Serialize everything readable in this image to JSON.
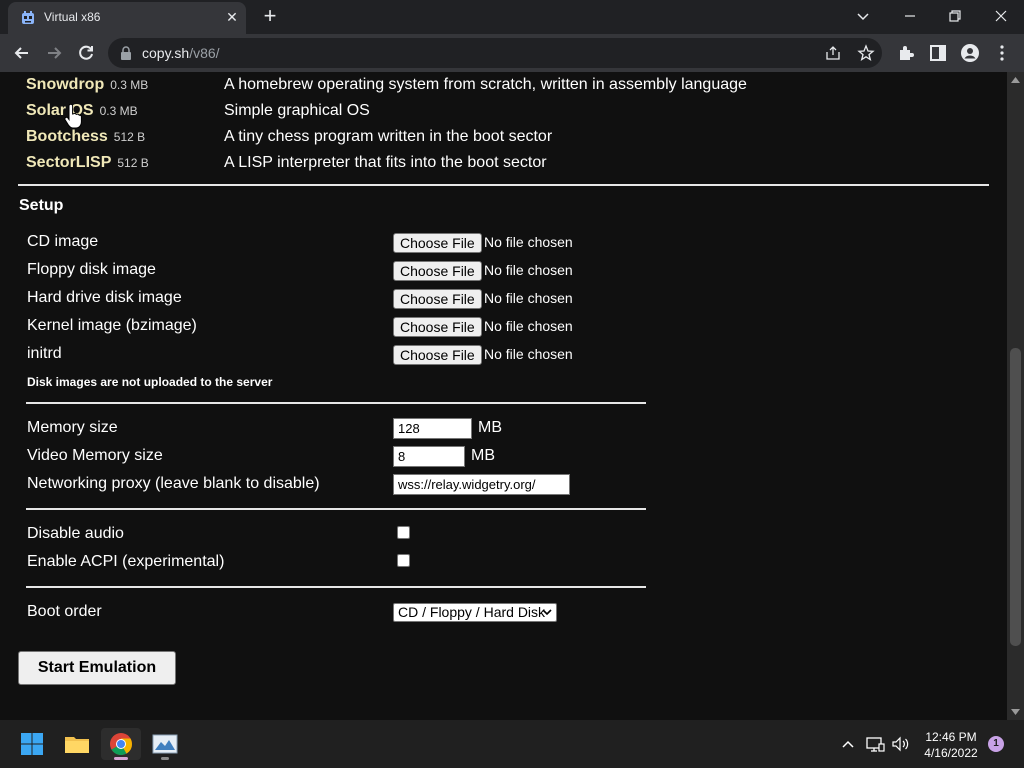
{
  "browser": {
    "tab_title": "Virtual x86",
    "url_host": "copy.sh",
    "url_path": "/v86/"
  },
  "os_list": [
    {
      "name": "Snowdrop",
      "size": "0.3 MB",
      "description": "A homebrew operating system from scratch, written in assembly language"
    },
    {
      "name": "Solar OS",
      "size": "0.3 MB",
      "description": "Simple graphical OS"
    },
    {
      "name": "Bootchess",
      "size": "512 B",
      "description": "A tiny chess program written in the boot sector"
    },
    {
      "name": "SectorLISP",
      "size": "512 B",
      "description": "A LISP interpreter that fits into the boot sector"
    }
  ],
  "setup": {
    "title": "Setup",
    "file_inputs": [
      {
        "label": "CD image",
        "button": "Choose File",
        "status": "No file chosen"
      },
      {
        "label": "Floppy disk image",
        "button": "Choose File",
        "status": "No file chosen"
      },
      {
        "label": "Hard drive disk image",
        "button": "Choose File",
        "status": "No file chosen"
      },
      {
        "label": "Kernel image (bzimage)",
        "button": "Choose File",
        "status": "No file chosen"
      },
      {
        "label": "initrd",
        "button": "Choose File",
        "status": "No file chosen"
      }
    ],
    "disk_note": "Disk images are not uploaded to the server",
    "memory_label": "Memory size",
    "memory_value": "128",
    "memory_unit": "MB",
    "video_memory_label": "Video Memory size",
    "video_memory_value": "8",
    "video_memory_unit": "MB",
    "proxy_label": "Networking proxy (leave blank to disable)",
    "proxy_value": "wss://relay.widgetry.org/",
    "disable_audio_label": "Disable audio",
    "enable_acpi_label": "Enable ACPI (experimental)",
    "boot_order_label": "Boot order",
    "boot_order_value": "CD / Floppy / Hard Disk",
    "start_button": "Start Emulation"
  },
  "taskbar": {
    "time": "12:46 PM",
    "date": "4/16/2022",
    "notification_count": "1"
  }
}
